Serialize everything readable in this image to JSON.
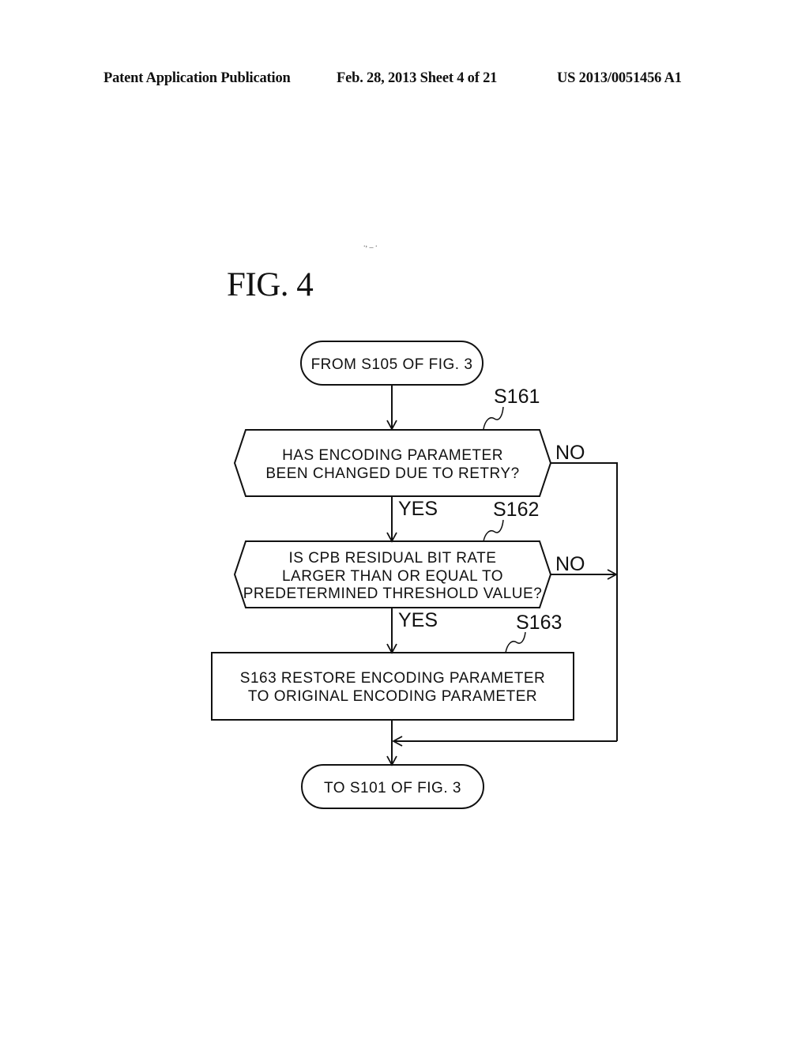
{
  "header": {
    "publication": "Patent Application Publication",
    "date_sheet": "Feb. 28, 2013   Sheet 4 of 21",
    "patent_number": "US 2013/0051456 A1"
  },
  "figure": {
    "title": "FIG. 4",
    "speck": ".,  _ ."
  },
  "flowchart": {
    "start": {
      "text": "FROM S105 OF FIG. 3"
    },
    "decision1": {
      "step": "S161",
      "lines": [
        "HAS ENCODING PARAMETER",
        "BEEN CHANGED DUE TO RETRY?"
      ],
      "yes_label": "YES",
      "no_label": "NO"
    },
    "decision2": {
      "step": "S162",
      "lines": [
        "IS CPB RESIDUAL BIT RATE",
        "LARGER THAN OR EQUAL TO",
        "PREDETERMINED THRESHOLD VALUE?"
      ],
      "yes_label": "YES",
      "no_label": "NO"
    },
    "process1": {
      "step": "S163",
      "lines": [
        "S163 RESTORE ENCODING PARAMETER",
        "TO ORIGINAL ENCODING PARAMETER"
      ]
    },
    "end": {
      "text": "TO S101 OF FIG. 3"
    }
  }
}
